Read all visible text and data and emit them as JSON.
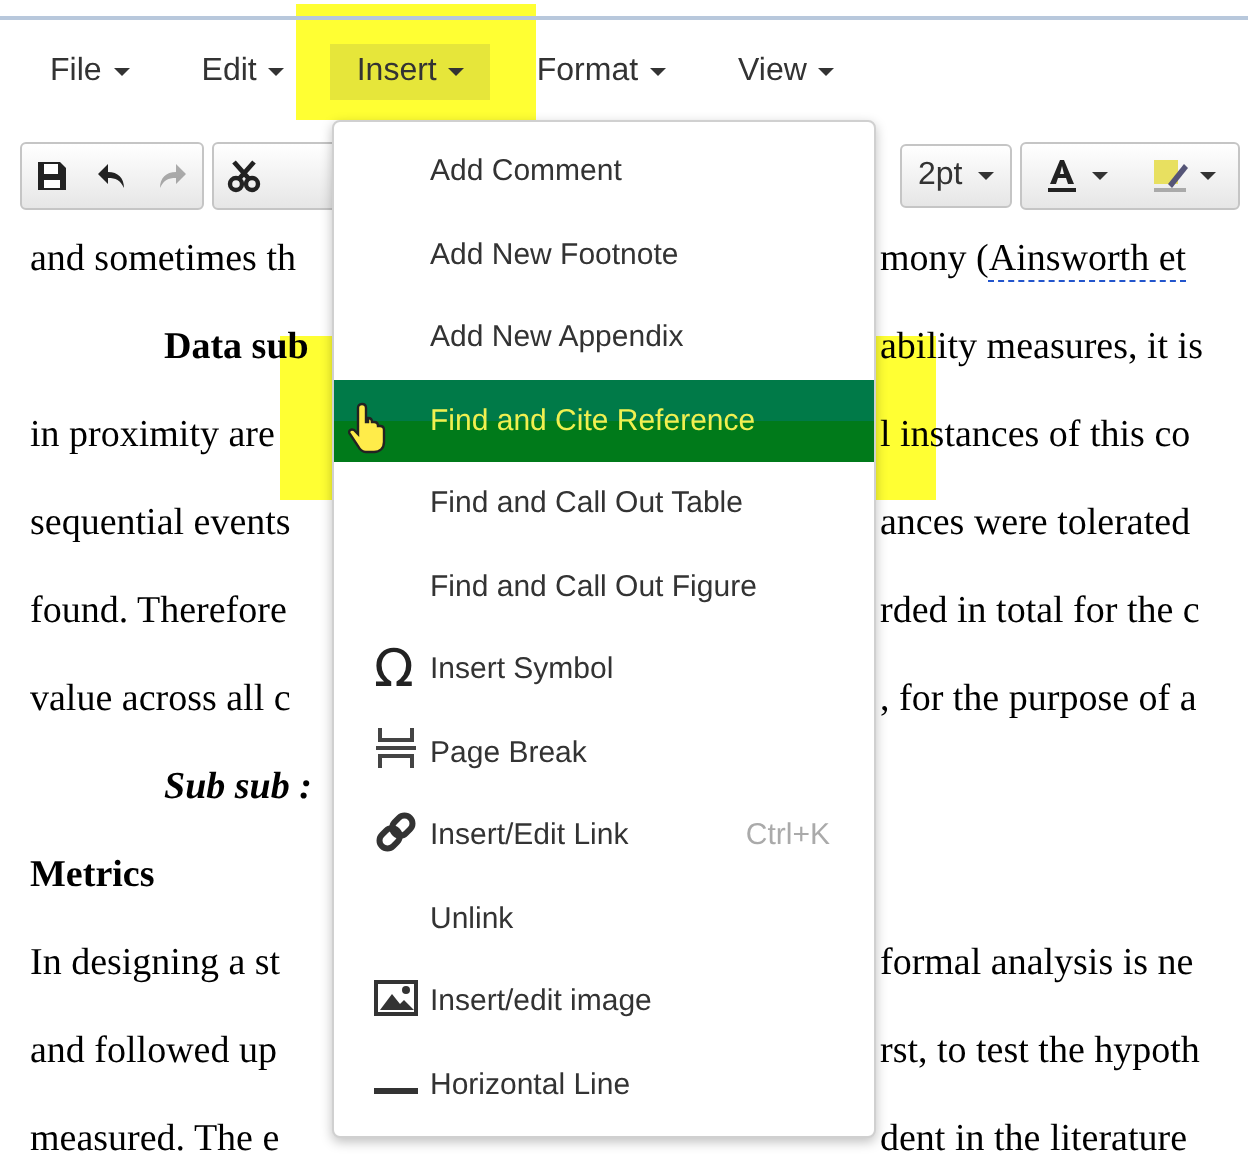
{
  "menubar": [
    {
      "label": "File",
      "selected": false
    },
    {
      "label": "Edit",
      "selected": false
    },
    {
      "label": "Insert",
      "selected": true,
      "highlighted": true
    },
    {
      "label": "Format",
      "selected": false
    },
    {
      "label": "View",
      "selected": false
    }
  ],
  "toolbar": {
    "buttons": [
      {
        "disabled": false
      },
      {
        "disabled": false
      },
      {
        "disabled": true
      }
    ],
    "font_size": "2pt"
  },
  "document": [
    {
      "kind": "text",
      "left": "and sometimes th",
      "right": "mony (",
      "link": "Ainsworth et"
    },
    {
      "kind": "bold-indent",
      "left": "Data sub",
      "right": "ability measures, it is"
    },
    {
      "kind": "text",
      "left": "in proximity are",
      "right": "l instances of this co"
    },
    {
      "kind": "text",
      "left": "sequential events",
      "right": "ances were tolerated"
    },
    {
      "kind": "text",
      "left": "found. Therefore",
      "right": "rded in total for the c"
    },
    {
      "kind": "text",
      "left": "value across all c",
      "right": ", for the purpose of a"
    },
    {
      "kind": "bold-italic-indent",
      "left": "Sub sub :"
    },
    {
      "kind": "heading",
      "left": "Metrics"
    },
    {
      "kind": "text",
      "left": "In designing a st",
      "right": "formal analysis is ne"
    },
    {
      "kind": "text",
      "left": "and followed up",
      "right": "rst, to test the hypoth"
    },
    {
      "kind": "text",
      "left": "measured. The e",
      "right": "dent in the literature"
    }
  ],
  "insert_menu": [
    {
      "label": "Add Comment",
      "selected": false
    },
    {
      "label": "Add New Footnote",
      "selected": false
    },
    {
      "label": "Add New Appendix",
      "selected": false
    },
    {
      "label": "Find and Cite Reference",
      "selected": true,
      "highlighted": true
    },
    {
      "label": "Find and Call Out Table",
      "selected": false
    },
    {
      "label": "Find and Call Out Figure",
      "selected": false
    },
    {
      "label": "Insert Symbol",
      "selected": false,
      "symbol": "Ω"
    },
    {
      "label": "Page Break",
      "selected": false
    },
    {
      "label": "Insert/Edit Link",
      "selected": false,
      "shortcut": "Ctrl+K"
    },
    {
      "label": "Unlink",
      "selected": false
    },
    {
      "label": "Insert/edit image",
      "selected": false
    },
    {
      "label": "Horizontal Line",
      "selected": false
    }
  ]
}
